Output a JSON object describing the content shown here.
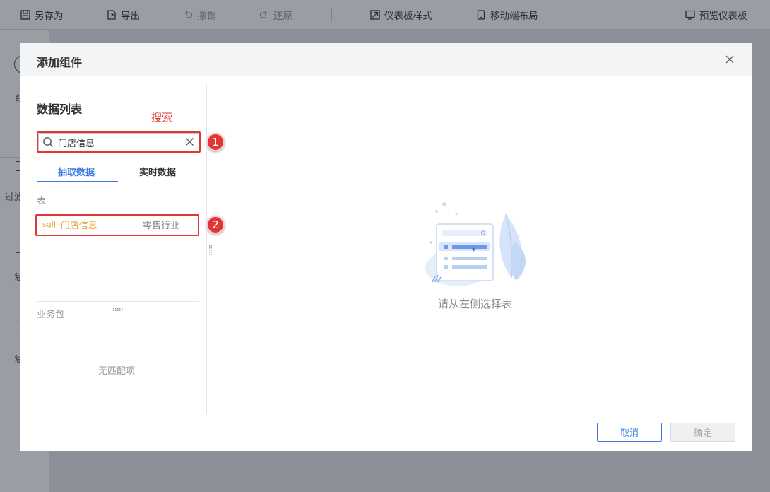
{
  "toolbar": {
    "save_as": "另存为",
    "export": "导出",
    "undo": "撤销",
    "redo": "还原",
    "dashboard_style": "仪表板样式",
    "mobile_layout": "移动端布局",
    "preview": "预览仪表板"
  },
  "side_fragments": {
    "a": "组",
    "b": "过滤",
    "c": "复",
    "d": "复"
  },
  "modal": {
    "title": "添加组件",
    "left": {
      "title": "数据列表",
      "annotation": "搜索",
      "search_value": "门店信息",
      "badge1": "1",
      "badge2": "2",
      "tabs": [
        "抽取数据",
        "实时数据"
      ],
      "table_section": "表",
      "result": {
        "type_tag": "sql",
        "name": "门店信息",
        "folder": "零售行业"
      },
      "package_section": "业务包",
      "no_match": "无匹配项"
    },
    "right": {
      "empty_text": "请从左侧选择表"
    },
    "buttons": {
      "cancel": "取消",
      "ok": "确定"
    }
  },
  "colors": {
    "accent": "#3c7be0",
    "annotation": "#e23636",
    "sql_tag": "#e8a33a"
  }
}
